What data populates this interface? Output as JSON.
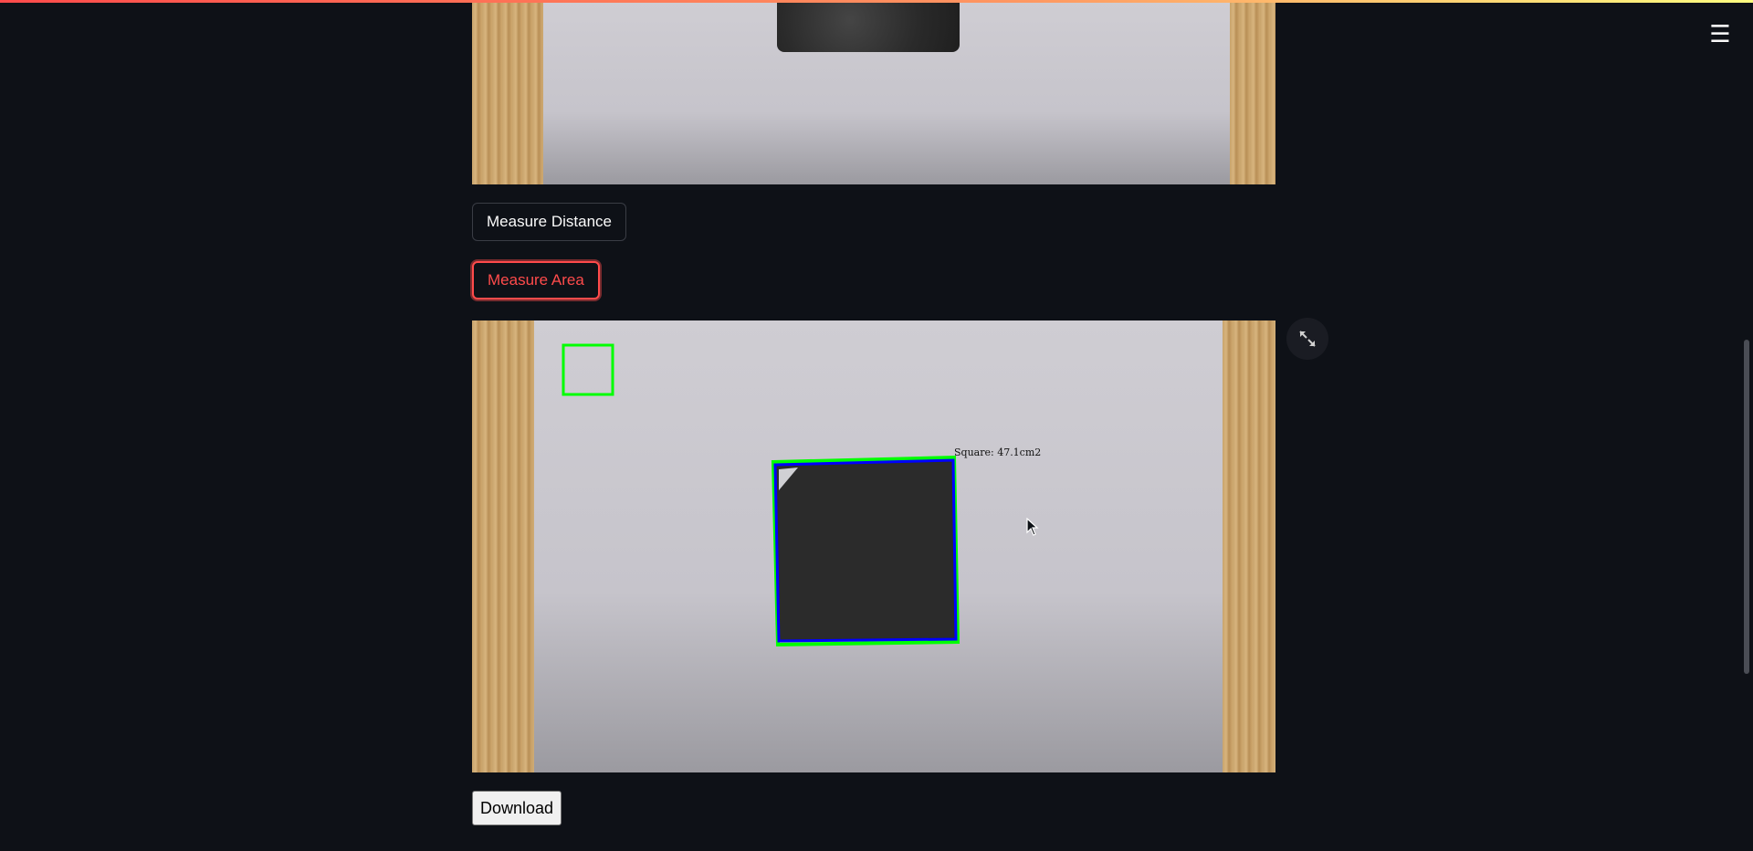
{
  "buttons": {
    "measure_distance": "Measure Distance",
    "measure_area": "Measure Area",
    "download": "Download"
  },
  "result_image": {
    "annotation_label": "Square: 47.1cm2"
  },
  "icons": {
    "menu": "hamburger-menu-icon",
    "fullscreen": "expand-fullscreen-icon"
  },
  "colors": {
    "background": "#0e1117",
    "accent": "#ff4b4b",
    "contour_green": "#00ff00",
    "contour_blue": "#0000ff"
  }
}
